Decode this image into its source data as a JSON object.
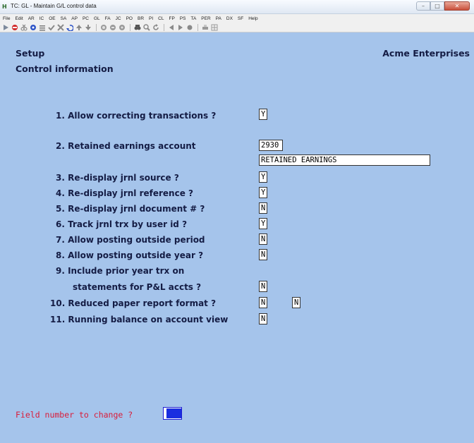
{
  "window": {
    "title": "TC: GL - Maintain G/L control data",
    "app_icon": "TC-app-icon",
    "buttons": {
      "minimize": "minimize-icon",
      "maximize": "maximize-icon",
      "close": "close-icon"
    }
  },
  "menubar": {
    "items": [
      "File",
      "Edit",
      "AR",
      "IC",
      "OE",
      "SA",
      "AP",
      "PC",
      "GL",
      "FA",
      "JC",
      "PO",
      "BR",
      "PI",
      "CL",
      "FP",
      "PS",
      "TA",
      "PER",
      "PA",
      "DX",
      "SF",
      "Help"
    ]
  },
  "toolbar": {
    "icons": [
      "run-icon",
      "stop-icon",
      "cut-icon",
      "gear-icon",
      "list-icon",
      "check-icon",
      "cancel-x-icon",
      "undo-icon",
      "up-arrow-icon",
      "down-arrow-icon",
      "circle-1-icon",
      "circle-2-icon",
      "circle-3-icon",
      "binoculars-icon",
      "zoom-icon",
      "refresh-icon",
      "prev-icon",
      "next-icon",
      "record-icon",
      "print-icon",
      "grid-icon"
    ]
  },
  "header": {
    "left": "Setup",
    "right": "Acme Enterprises",
    "subtitle": "Control information"
  },
  "fields": {
    "f1": {
      "label": "1. Allow correcting transactions ?",
      "value": "Y"
    },
    "f2": {
      "label": "2. Retained earnings account",
      "value": "2930",
      "description": "RETAINED EARNINGS"
    },
    "f3": {
      "label": "3. Re-display jrnl source ?",
      "value": "Y"
    },
    "f4": {
      "label": "4. Re-display jrnl reference ?",
      "value": "Y"
    },
    "f5": {
      "label": "5. Re-display jrnl document # ?",
      "value": "N"
    },
    "f6": {
      "label": "6. Track jrnl trx by user id ?",
      "value": "Y"
    },
    "f7": {
      "label": "7. Allow posting outside period",
      "value": "N"
    },
    "f8": {
      "label": "8. Allow posting outside year ?",
      "value": "N"
    },
    "f9": {
      "label_line1": "9. Include prior year trx on",
      "label_line2": "statements for P&L accts ?",
      "value": "N"
    },
    "f10": {
      "label": "10. Reduced paper report format ?",
      "value": "N",
      "value2": "N"
    },
    "f11": {
      "label": "11. Running balance on account view",
      "value": "N"
    }
  },
  "prompt": {
    "text": "Field number to change ?",
    "value": ""
  },
  "colors": {
    "screen_bg": "#a5c4eb",
    "label_text": "#141c44",
    "prompt_text": "#d91c3a",
    "cursor_block": "#1a2ee0"
  }
}
